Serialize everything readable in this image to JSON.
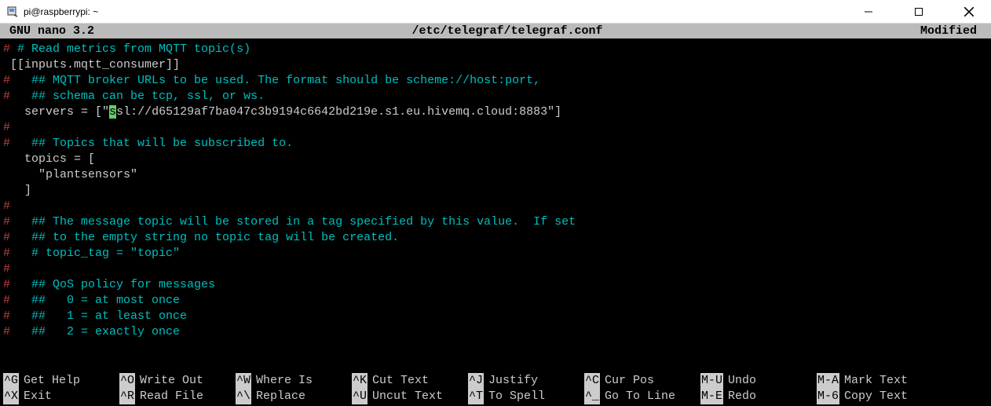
{
  "window": {
    "title": "pi@raspberrypi: ~"
  },
  "status": {
    "app": "GNU nano 3.2",
    "file": "/etc/telegraf/telegraf.conf",
    "modified": "Modified"
  },
  "editor_lines": [
    {
      "hash": "#",
      "text": " # Read metrics from MQTT topic(s)",
      "cls": "cyan"
    },
    {
      "hash": "",
      "text": "[[inputs.mqtt_consumer]]",
      "cls": "white"
    },
    {
      "hash": "#",
      "text": "   ## MQTT broker URLs to be used. The format should be scheme://host:port,",
      "cls": "cyan"
    },
    {
      "hash": "#",
      "text": "   ## schema can be tcp, ssl, or ws.",
      "cls": "cyan"
    },
    {
      "hash": "",
      "text_before": "  servers = [\"",
      "cursor_char": "s",
      "text_after": "sl://d65129af7ba047c3b9194c6642bd219e.s1.eu.hivemq.cloud:8883\"]",
      "cls": "white",
      "has_cursor": true
    },
    {
      "hash": "#",
      "text": "",
      "cls": "cyan"
    },
    {
      "hash": "#",
      "text": "   ## Topics that will be subscribed to.",
      "cls": "cyan"
    },
    {
      "hash": "",
      "text": "  topics = [",
      "cls": "white"
    },
    {
      "hash": "",
      "text": "    \"plantsensors\"",
      "cls": "white"
    },
    {
      "hash": "",
      "text": "  ]",
      "cls": "white"
    },
    {
      "hash": "#",
      "text": "",
      "cls": "cyan"
    },
    {
      "hash": "#",
      "text": "   ## The message topic will be stored in a tag specified by this value.  If set",
      "cls": "cyan"
    },
    {
      "hash": "#",
      "text": "   ## to the empty string no topic tag will be created.",
      "cls": "cyan"
    },
    {
      "hash": "#",
      "text": "   # topic_tag = \"topic\"",
      "cls": "cyan"
    },
    {
      "hash": "#",
      "text": "",
      "cls": "cyan"
    },
    {
      "hash": "#",
      "text": "   ## QoS policy for messages",
      "cls": "cyan"
    },
    {
      "hash": "#",
      "text": "   ##   0 = at most once",
      "cls": "cyan"
    },
    {
      "hash": "#",
      "text": "   ##   1 = at least once",
      "cls": "cyan"
    },
    {
      "hash": "#",
      "text": "   ##   2 = exactly once",
      "cls": "cyan"
    }
  ],
  "help": {
    "row1": [
      {
        "key": "^G",
        "label": "Get Help"
      },
      {
        "key": "^O",
        "label": "Write Out"
      },
      {
        "key": "^W",
        "label": "Where Is"
      },
      {
        "key": "^K",
        "label": "Cut Text"
      },
      {
        "key": "^J",
        "label": "Justify"
      },
      {
        "key": "^C",
        "label": "Cur Pos"
      },
      {
        "key": "M-U",
        "label": "Undo"
      },
      {
        "key": "M-A",
        "label": "Mark Text"
      }
    ],
    "row2": [
      {
        "key": "^X",
        "label": "Exit"
      },
      {
        "key": "^R",
        "label": "Read File"
      },
      {
        "key": "^\\",
        "label": "Replace"
      },
      {
        "key": "^U",
        "label": "Uncut Text"
      },
      {
        "key": "^T",
        "label": "To Spell"
      },
      {
        "key": "^_",
        "label": "Go To Line"
      },
      {
        "key": "M-E",
        "label": "Redo"
      },
      {
        "key": "M-6",
        "label": "Copy Text"
      }
    ]
  }
}
